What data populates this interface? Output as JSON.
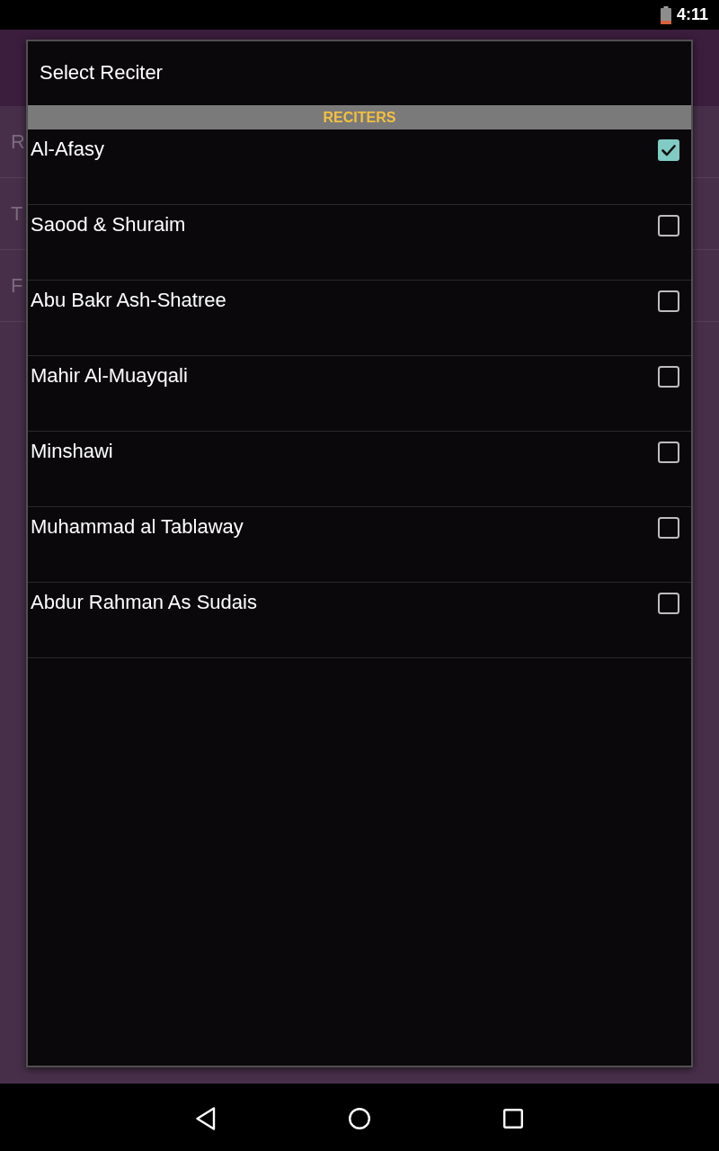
{
  "status_bar": {
    "time": "4:11"
  },
  "background": {
    "rows": [
      {
        "label": "R"
      },
      {
        "label": "T"
      },
      {
        "label": "F"
      }
    ]
  },
  "dialog": {
    "title": "Select Reciter",
    "section": "RECITERS",
    "reciters": [
      {
        "name": "Al-Afasy",
        "checked": true
      },
      {
        "name": "Saood & Shuraim",
        "checked": false
      },
      {
        "name": "Abu Bakr Ash-Shatree",
        "checked": false
      },
      {
        "name": "Mahir Al-Muayqali",
        "checked": false
      },
      {
        "name": "Minshawi",
        "checked": false
      },
      {
        "name": "Muhammad al Tablaway",
        "checked": false
      },
      {
        "name": "Abdur Rahman As Sudais",
        "checked": false
      }
    ]
  }
}
